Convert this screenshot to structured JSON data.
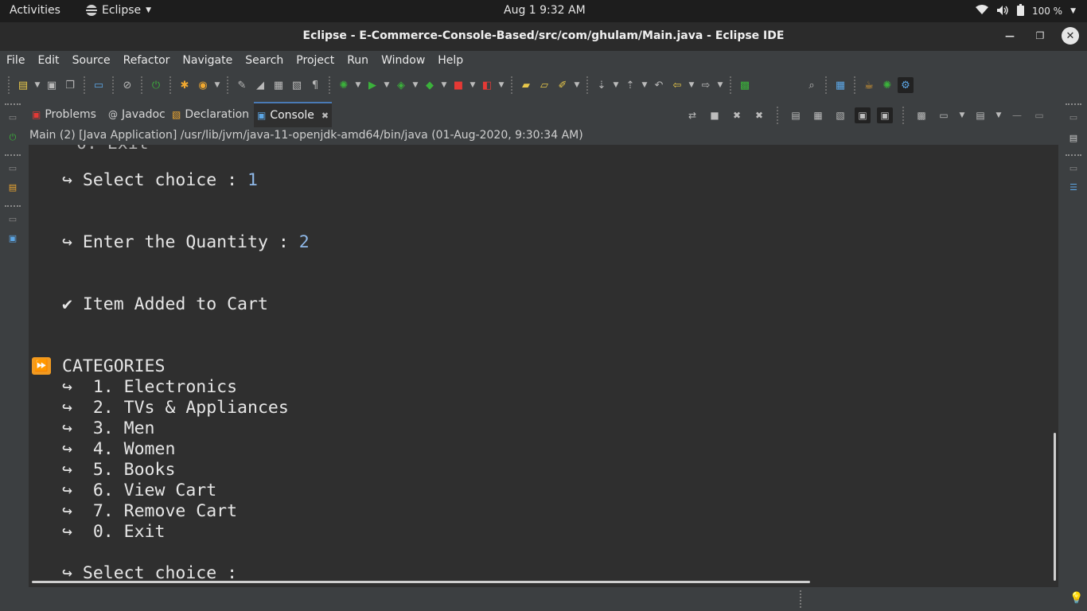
{
  "topbar": {
    "activities": "Activities",
    "app_name": "Eclipse",
    "clock": "Aug 1   9:32 AM",
    "battery": "100 %"
  },
  "window": {
    "title": "Eclipse - E-Commerce-Console-Based/src/com/ghulam/Main.java - Eclipse IDE"
  },
  "menubar": {
    "items": [
      "File",
      "Edit",
      "Source",
      "Refactor",
      "Navigate",
      "Search",
      "Project",
      "Run",
      "Window",
      "Help"
    ]
  },
  "views": {
    "tabs": [
      {
        "label": "Problems",
        "icon": "problems-icon"
      },
      {
        "label": "Javadoc",
        "icon": "javadoc-icon"
      },
      {
        "label": "Declaration",
        "icon": "declaration-icon"
      },
      {
        "label": "Console",
        "icon": "console-icon",
        "active": true
      }
    ]
  },
  "console": {
    "launch_info": "Main (2) [Java Application] /usr/lib/jvm/java-11-openjdk-amd64/bin/java  (01-Aug-2020, 9:30:34 AM)",
    "select_prompt": "↪ Select choice : ",
    "select_value": "1",
    "quantity_prompt": "↪ Enter the Quantity : ",
    "quantity_value": "2",
    "added_msg": "✔ Item Added to Cart",
    "categories_title": "CATEGORIES",
    "categories": [
      "↪  1. Electronics",
      "↪  2. TVs & Appliances",
      "↪  3. Men",
      "↪  4. Women",
      "↪  5. Books",
      "↪  6. View Cart",
      "↪  7. Remove Cart",
      "↪  0. Exit"
    ],
    "final_prompt": "↪ Select choice :"
  },
  "colors": {
    "input_value": "#8fb8e8",
    "categories_badge": "#f29a20",
    "active_tab_accent": "#4a7ab5"
  }
}
